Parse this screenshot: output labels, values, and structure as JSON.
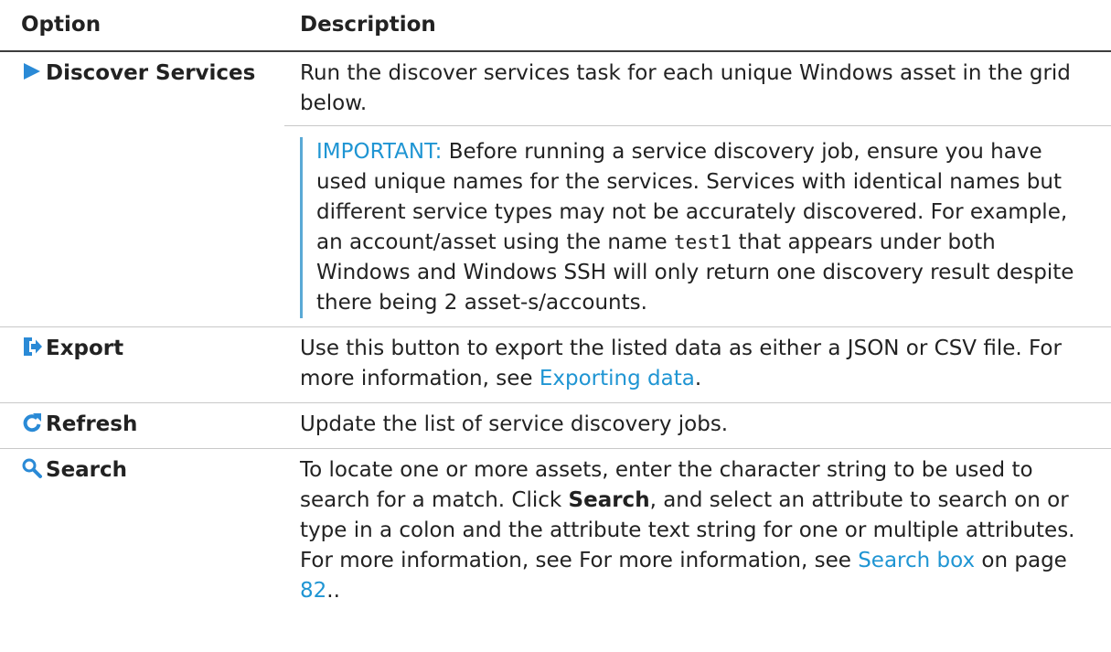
{
  "header": {
    "option": "Option",
    "description": "Description"
  },
  "rows": [
    {
      "icon": "play-icon",
      "label": "Discover Services",
      "description": "Run the discover services task for each unique Windows asset in the grid below.",
      "note": {
        "prefix": "IMPORTANT:",
        "text1": " Before running a service discovery job, ensure you have used unique names for the services. Services with identical names but different service types may not be accurately discovered. For example, an account/asset using the name ",
        "code": "test1",
        "text2": " that appears under both Windows and Windows SSH will only return one discovery result despite there being 2 asset-s/accounts."
      }
    },
    {
      "icon": "export-icon",
      "label": "Export",
      "desc1": "Use this button to export the listed data as either a JSON or CSV file. For more information, see ",
      "link": "Exporting data",
      "desc2": "."
    },
    {
      "icon": "refresh-icon",
      "label": "Refresh",
      "description": "Update the list of service discovery jobs."
    },
    {
      "icon": "search-icon",
      "label": "Search",
      "desc1": "To locate one or more assets, enter the character string to be used to search for a match. Click ",
      "bold": "Search",
      "desc2": ", and select an attribute to search on or type in a colon and the attribute text string for one or multiple attributes. For more information, see For more information, see ",
      "link": "Search box",
      "desc3": " on page ",
      "page": "82",
      "desc4": ".."
    }
  ],
  "colors": {
    "accent": "#1f95d3",
    "note_bar": "#5aa9d6",
    "icon_blue": "#2a8ad6"
  }
}
